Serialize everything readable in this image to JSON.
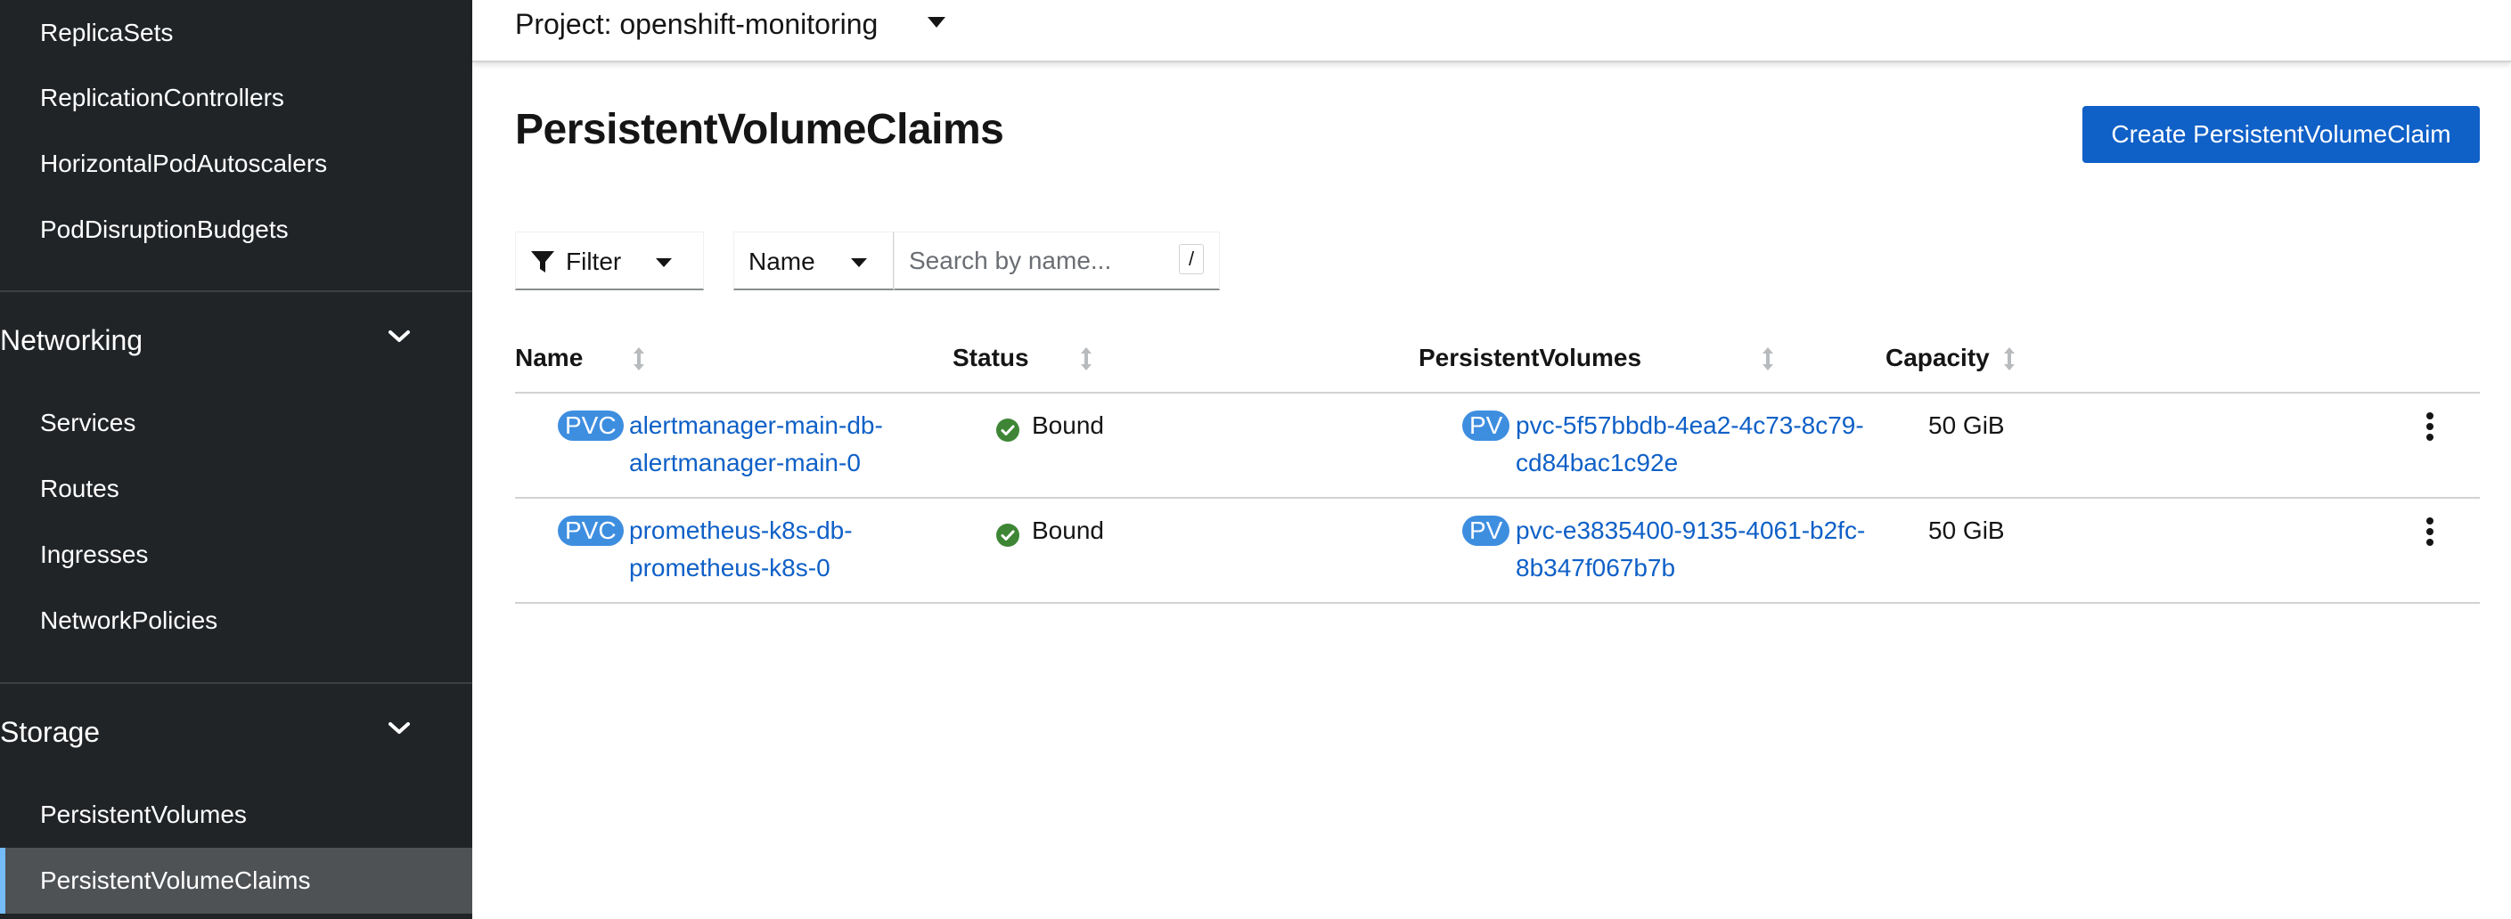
{
  "sidebar": {
    "workloads_items": [
      {
        "label": "ReplicaSets"
      },
      {
        "label": "ReplicationControllers"
      },
      {
        "label": "HorizontalPodAutoscalers"
      },
      {
        "label": "PodDisruptionBudgets"
      }
    ],
    "networking": {
      "label": "Networking",
      "items": [
        {
          "label": "Services"
        },
        {
          "label": "Routes"
        },
        {
          "label": "Ingresses"
        },
        {
          "label": "NetworkPolicies"
        }
      ]
    },
    "storage": {
      "label": "Storage",
      "items": [
        {
          "label": "PersistentVolumes"
        },
        {
          "label": "PersistentVolumeClaims",
          "active": true
        }
      ]
    }
  },
  "header": {
    "project_label": "Project: openshift-monitoring"
  },
  "page": {
    "title": "PersistentVolumeClaims",
    "create_button": "Create PersistentVolumeClaim"
  },
  "toolbar": {
    "filter_label": "Filter",
    "name_select": "Name",
    "search_placeholder": "Search by name...",
    "search_shortcut": "/"
  },
  "table": {
    "columns": [
      "Name",
      "Status",
      "PersistentVolumes",
      "Capacity"
    ],
    "rows": [
      {
        "name_badge": "PVC",
        "name_line1": "alertmanager-main-db-",
        "name_line2": "alertmanager-main-0",
        "status": "Bound",
        "pv_badge": "PV",
        "pv_line1": "pvc-5f57bbdb-4ea2-4c73-8c79-",
        "pv_line2": "cd84bac1c92e",
        "capacity": "50 GiB"
      },
      {
        "name_badge": "PVC",
        "name_line1": "prometheus-k8s-db-",
        "name_line2": "prometheus-k8s-0",
        "status": "Bound",
        "pv_badge": "PV",
        "pv_line1": "pvc-e3835400-9135-4061-b2fc-",
        "pv_line2": "8b347f067b7b",
        "capacity": "50 GiB"
      }
    ]
  },
  "colors": {
    "sidebar_bg": "#212427",
    "active_item_bg": "#4f5255",
    "primary": "#0f60c7",
    "badge": "#3e8ee0",
    "success": "#3e8635"
  },
  "icons": {
    "filter": "filter-icon",
    "caret": "caret-down-icon",
    "chevron": "chevron-down-icon",
    "sort": "sort-icon",
    "status_ok": "check-circle-icon",
    "kebab": "kebab-icon"
  }
}
